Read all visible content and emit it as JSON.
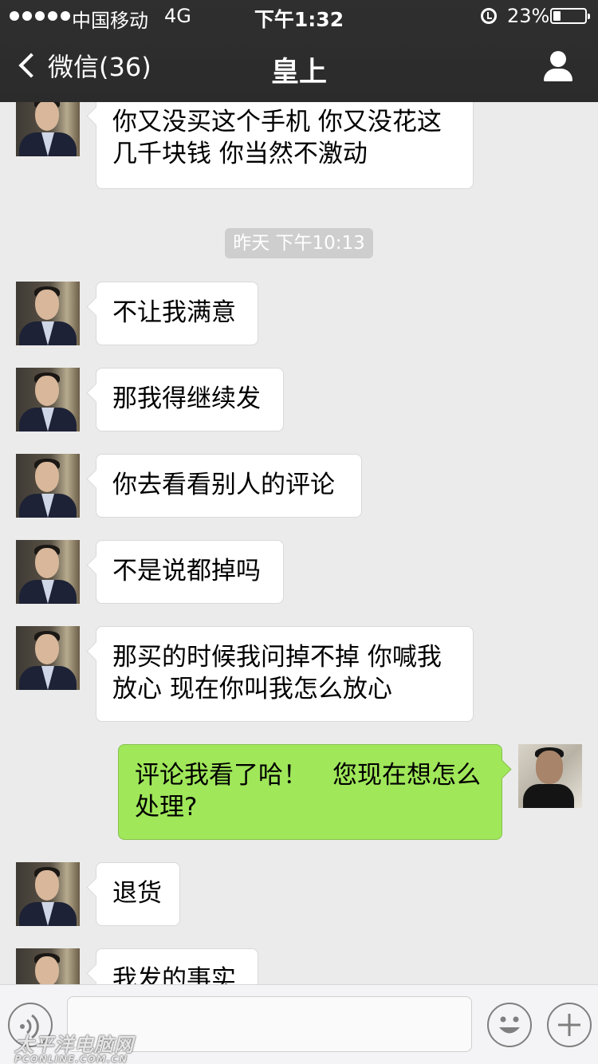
{
  "status_bar": {
    "carrier": "中国移动",
    "network": "4G",
    "time": "下午1:32",
    "battery_percent": "23%",
    "battery_level": 0.23,
    "signal_icon": "signal-dots-icon",
    "alarm_icon": "alarm-icon",
    "battery_icon": "battery-icon"
  },
  "nav": {
    "back_label": "微信(36)",
    "title": "皇上",
    "back_icon": "chevron-left-icon",
    "profile_icon": "person-icon"
  },
  "chat": {
    "timestamp": "昨天 下午10:13",
    "messages": [
      {
        "side": "left",
        "text": "你又没买这个手机 你又没花这几千块钱 你当然不激动"
      },
      {
        "side": "left",
        "text": "不让我满意"
      },
      {
        "side": "left",
        "text": "那我得继续发"
      },
      {
        "side": "left",
        "text": "你去看看别人的评论"
      },
      {
        "side": "left",
        "text": "不是说都掉吗"
      },
      {
        "side": "left",
        "text": "那买的时候我问掉不掉 你喊我放心 现在你叫我怎么放心"
      },
      {
        "side": "right",
        "text": "评论我看了哈！　您现在想怎么处理?"
      },
      {
        "side": "left",
        "text": "退货"
      },
      {
        "side": "left",
        "text": "我发的事实"
      }
    ]
  },
  "toolbar": {
    "voice_icon": "voice-icon",
    "emoji_icon": "emoji-icon",
    "plus_icon": "plus-icon",
    "input_value": ""
  },
  "watermark": {
    "text": "太平洋电脑网",
    "sub": "PCONLINE.COM.CN"
  },
  "colors": {
    "nav_background": "#2f2f2f",
    "chat_background": "#ebebeb",
    "sent_bubble": "#a0e75a",
    "received_bubble": "#ffffff",
    "timestamp_pill": "#cecece"
  }
}
